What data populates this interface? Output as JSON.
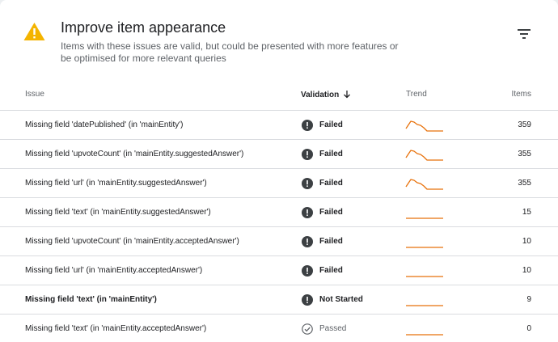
{
  "header": {
    "title": "Improve item appearance",
    "subtitle": "Items with these issues are valid, but could be presented with more features or be optimised for more relevant queries",
    "warning_color": "#f4b400"
  },
  "table": {
    "columns": {
      "issue": "Issue",
      "validation": "Validation",
      "trend": "Trend",
      "items": "Items"
    },
    "rows": [
      {
        "issue": "Missing field 'datePublished' (in 'mainEntity')",
        "validation": "Failed",
        "status": "failed",
        "trend": "drop",
        "items": "359",
        "bold": false
      },
      {
        "issue": "Missing field 'upvoteCount' (in 'mainEntity.suggestedAnswer')",
        "validation": "Failed",
        "status": "failed",
        "trend": "drop",
        "items": "355",
        "bold": false
      },
      {
        "issue": "Missing field 'url' (in 'mainEntity.suggestedAnswer')",
        "validation": "Failed",
        "status": "failed",
        "trend": "drop",
        "items": "355",
        "bold": false
      },
      {
        "issue": "Missing field 'text' (in 'mainEntity.suggestedAnswer')",
        "validation": "Failed",
        "status": "failed",
        "trend": "flat",
        "items": "15",
        "bold": false
      },
      {
        "issue": "Missing field 'upvoteCount' (in 'mainEntity.acceptedAnswer')",
        "validation": "Failed",
        "status": "failed",
        "trend": "flat",
        "items": "10",
        "bold": false
      },
      {
        "issue": "Missing field 'url' (in 'mainEntity.acceptedAnswer')",
        "validation": "Failed",
        "status": "failed",
        "trend": "flat",
        "items": "10",
        "bold": false
      },
      {
        "issue": "Missing field 'text' (in 'mainEntity')",
        "validation": "Not Started",
        "status": "not-started",
        "trend": "flat",
        "items": "9",
        "bold": true
      },
      {
        "issue": "Missing field 'text' (in 'mainEntity.acceptedAnswer')",
        "validation": "Passed",
        "status": "passed",
        "trend": "flat",
        "items": "0",
        "bold": false
      }
    ]
  },
  "icons": {
    "warning": "warning-triangle-icon",
    "filter": "filter-icon",
    "sort": "arrow-down-icon",
    "failed": "exclamation-circle-icon",
    "passed": "check-circle-icon"
  },
  "colors": {
    "trend_line": "#e8710a",
    "status_icon": "#3c4043",
    "divider": "#dadce0"
  }
}
